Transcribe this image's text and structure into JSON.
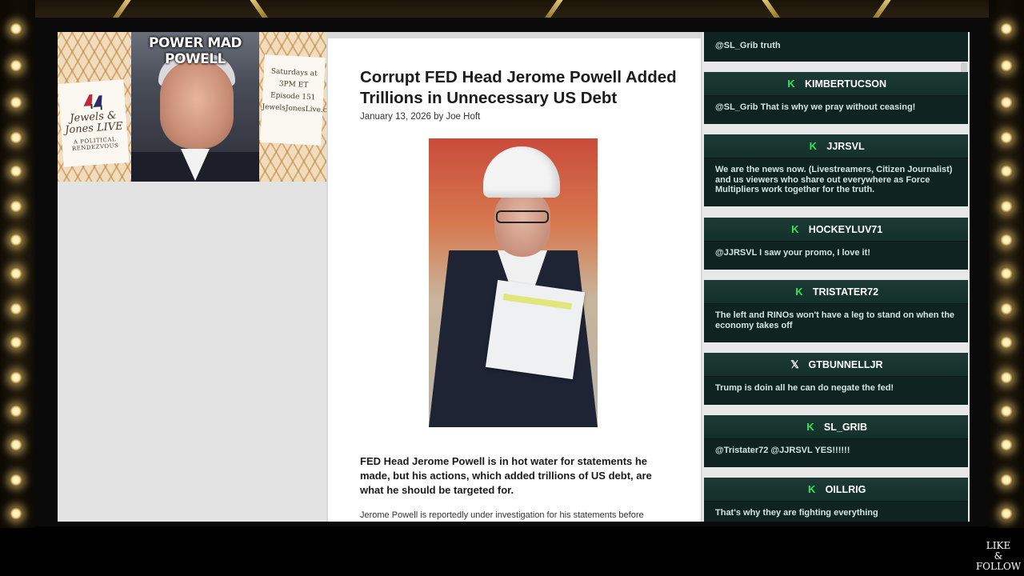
{
  "show": {
    "title": "POWER MAD POWELL",
    "brand_big": "Jewels & Jones LIVE",
    "brand_small": "A POLITICAL RENDEZVOUS",
    "schedule_lines": [
      "Saturdays at 3PM ET",
      "Episode 151",
      "JewelsJonesLive.com"
    ]
  },
  "article": {
    "headline": "Corrupt FED Head Jerome Powell Added Trillions in Unnecessary US Debt",
    "byline": "January 13, 2026 by Joe Hoft",
    "lead": "FED Head Jerome Powell is in hot water for statements he made, but his actions, which added trillions of US debt, are what he should be targeted for.",
    "body_start": "Jerome Powell is reportedly under investigation for his statements before"
  },
  "chat": {
    "first_message": "@SL_Grib truth",
    "messages": [
      {
        "platform": "kick",
        "platform_glyph": "K",
        "user": "KIMBERTUCSON",
        "text": "@SL_Grib That is why we pray without ceasing!"
      },
      {
        "platform": "kick",
        "platform_glyph": "K",
        "user": "JJRSVL",
        "text": "We are the news now. (Livestreamers, Citizen Journalist) and us viewers who share out everywhere as Force Multipliers work together for the truth."
      },
      {
        "platform": "kick",
        "platform_glyph": "K",
        "user": "HOCKEYLUV71",
        "text": "@JJRSVL I saw your promo, I love it!"
      },
      {
        "platform": "kick",
        "platform_glyph": "K",
        "user": "TRISTATER72",
        "text": "The left and RINOs won't have a leg to stand on when the economy takes off"
      },
      {
        "platform": "x",
        "platform_glyph": "𝕏",
        "user": "GTBUNNELLJR",
        "text": "Trump is doin all he can do negate the fed!"
      },
      {
        "platform": "kick",
        "platform_glyph": "K",
        "user": "SL_GRIB",
        "text": "@Tristater72 @JJRSVL YES!!!!!!"
      },
      {
        "platform": "kick",
        "platform_glyph": "K",
        "user": "OILLRIG",
        "text": "That's why they are fighting everything"
      }
    ]
  },
  "overlay": {
    "like_follow_lines": [
      "LIKE",
      "&",
      "FOLLOW"
    ]
  },
  "colors": {
    "kick_green": "#34e35a",
    "chat_bg": "#0f2421",
    "chat_name_bar": "#1d3a34",
    "chat_text": "#cfe7e0"
  }
}
